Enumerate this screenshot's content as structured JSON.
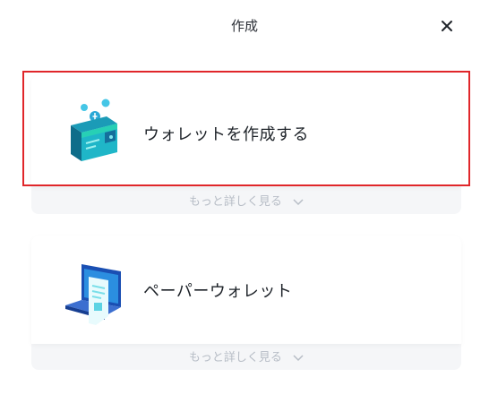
{
  "dialog": {
    "title": "作成",
    "close_icon": "close-icon"
  },
  "options": [
    {
      "label": "ウォレットを作成する",
      "icon": "wallet-icon",
      "more_label": "もっと詳しく見る",
      "selected": true
    },
    {
      "label": "ペーパーウォレット",
      "icon": "paper-wallet-icon",
      "more_label": "もっと詳しく見る",
      "selected": false
    }
  ],
  "colors": {
    "highlight": "#e0262a",
    "text": "#1e2329",
    "muted": "#b7bdc6",
    "accent": "#1fc7d4"
  }
}
